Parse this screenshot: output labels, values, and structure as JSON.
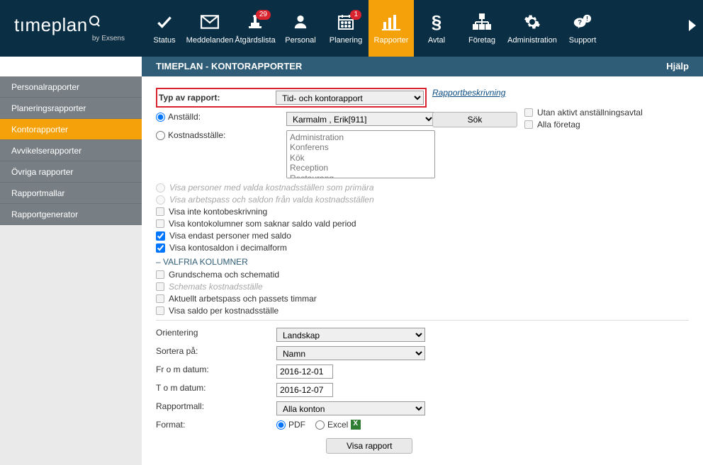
{
  "header": {
    "logo": "tımeplan",
    "logo_sub": "by Exsens",
    "nav": [
      {
        "id": "status",
        "label": "Status",
        "badge": null
      },
      {
        "id": "meddelanden",
        "label": "Meddelanden",
        "badge": null
      },
      {
        "id": "atgardslista",
        "label": "Åtgärdslista",
        "badge": "29"
      },
      {
        "id": "personal",
        "label": "Personal",
        "badge": null
      },
      {
        "id": "planering",
        "label": "Planering",
        "badge": "1"
      },
      {
        "id": "rapporter",
        "label": "Rapporter",
        "badge": null,
        "active": true
      },
      {
        "id": "avtal",
        "label": "Avtal",
        "badge": null
      },
      {
        "id": "foretag",
        "label": "Företag",
        "badge": null
      },
      {
        "id": "administration",
        "label": "Administration",
        "badge": null
      },
      {
        "id": "support",
        "label": "Support",
        "badge": null
      }
    ]
  },
  "subheader": {
    "title": "TIMEPLAN - KONTORAPPORTER",
    "help": "Hjälp"
  },
  "sidebar": {
    "items": [
      {
        "label": "Personalrapporter"
      },
      {
        "label": "Planeringsrapporter"
      },
      {
        "label": "Kontorapporter",
        "active": true
      },
      {
        "label": "Avvikelserapporter"
      },
      {
        "label": "Övriga rapporter"
      },
      {
        "label": "Rapportmallar"
      },
      {
        "label": "Rapportgenerator"
      }
    ]
  },
  "form": {
    "type_label": "Typ av rapport:",
    "type_value": "Tid- och kontorapport",
    "employee_label": "Anställd:",
    "employee_value": "Karmalm , Erik[911]",
    "cost_label": "Kostnadsställe:",
    "cost_options": [
      "Administration",
      "Konferens",
      "Kök",
      "Reception",
      "Restaurang"
    ],
    "cb_primary": "Visa personer med valda kostnadsställen som primära",
    "cb_passes": "Visa arbetspass och saldon från valda kostnadsställen",
    "cb_nodesc": "Visa inte kontobeskrivning",
    "cb_kontokol": "Visa kontokolumner som saknar saldo vald period",
    "cb_onlysaldo": "Visa endast personer med saldo",
    "cb_decimal": "Visa kontosaldon i decimalform",
    "valfria": "– VALFRIA KOLUMNER",
    "cb_grundschema": "Grundschema och schematid",
    "cb_schemakost": "Schemats kostnadsställe",
    "cb_aktuellt": "Aktuellt arbetspass och passets timmar",
    "cb_saldoper": "Visa saldo per kostnadsställe",
    "orientering_label": "Orientering",
    "orientering_value": "Landskap",
    "sortera_label": "Sortera på:",
    "sortera_value": "Namn",
    "from_label": "Fr o m datum:",
    "from_value": "2016-12-01",
    "to_label": "T o m datum:",
    "to_value": "2016-12-07",
    "rapportmall_label": "Rapportmall:",
    "rapportmall_value": "Alla konton",
    "format_label": "Format:",
    "format_pdf": "PDF",
    "format_excel": "Excel",
    "submit": "Visa rapport"
  },
  "rightcol": {
    "desc_link": "Rapportbeskrivning",
    "search_btn": "Sök",
    "cb_utan": "Utan aktivt anställningsavtal",
    "cb_alla": "Alla företag"
  }
}
